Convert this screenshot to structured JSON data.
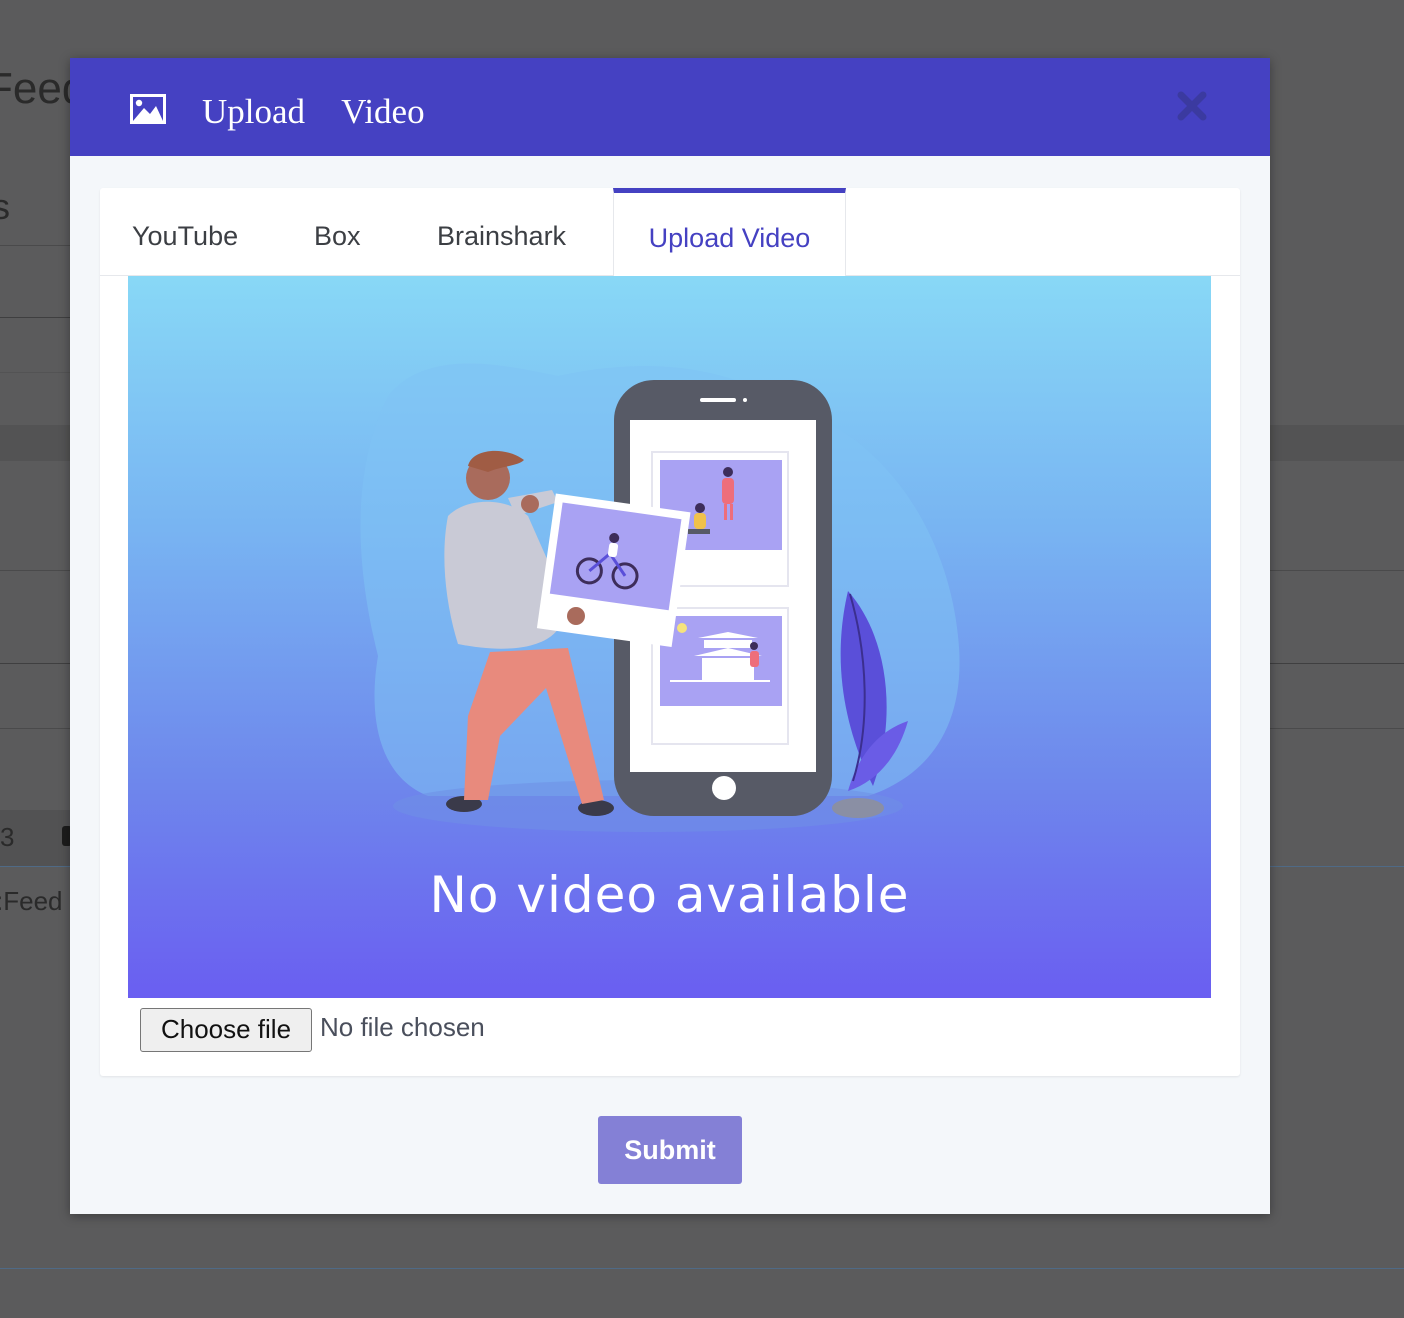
{
  "background": {
    "heading_fragment": "Feed",
    "s_fragment": "s",
    "number_fragment": "3",
    "feed_fragment": ":Feed"
  },
  "modal": {
    "title_icon": "image-icon",
    "title": "Upload Video",
    "close_icon": "close-icon",
    "accent_color": "#4541c2",
    "tabs": [
      {
        "label": "YouTube",
        "active": false
      },
      {
        "label": "Box",
        "active": false
      },
      {
        "label": "Brainshark",
        "active": false
      },
      {
        "label": "Upload Video",
        "active": true
      }
    ],
    "preview": {
      "message": "No video available",
      "illustration": "person-holding-photo-next-to-phone"
    },
    "file_input": {
      "button_label": "Choose file",
      "status": "No file chosen"
    },
    "submit_label": "Submit"
  }
}
